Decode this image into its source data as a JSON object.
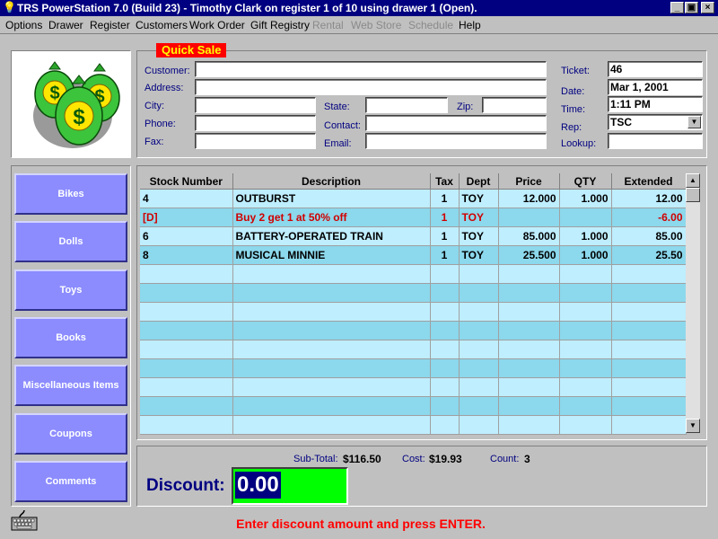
{
  "window": {
    "title": "TRS PowerStation 7.0 (Build 23) - Timothy Clark on register 1 of 10 using drawer 1 (Open).",
    "controls": {
      "minimize": "_",
      "maximize": "▣",
      "close": "×"
    }
  },
  "menu": [
    {
      "label": "Options",
      "enabled": true
    },
    {
      "label": "Drawer",
      "enabled": true
    },
    {
      "label": "Register",
      "enabled": true
    },
    {
      "label": "Customers",
      "enabled": true
    },
    {
      "label": "Work Order",
      "enabled": true
    },
    {
      "label": "Gift Registry",
      "enabled": true
    },
    {
      "label": "Rental",
      "enabled": false
    },
    {
      "label": "Web Store",
      "enabled": false
    },
    {
      "label": "Schedule",
      "enabled": false
    },
    {
      "label": "Help",
      "enabled": true
    }
  ],
  "header": {
    "mode_label": "Quick Sale",
    "customer": {
      "customer_label": "Customer:",
      "customer_value": "",
      "address_label": "Address:",
      "address_value": "",
      "city_label": "City:",
      "city_value": "",
      "state_label": "State:",
      "state_value": "",
      "zip_label": "Zip:",
      "zip_value": "",
      "phone_label": "Phone:",
      "phone_value": "",
      "contact_label": "Contact:",
      "contact_value": "",
      "fax_label": "Fax:",
      "fax_value": "",
      "email_label": "Email:",
      "email_value": ""
    },
    "ticket": {
      "ticket_label": "Ticket:",
      "ticket_value": "46",
      "date_label": "Date:",
      "date_value": "Mar 1, 2001",
      "time_label": "Time:",
      "time_value": "1:11 PM",
      "rep_label": "Rep:",
      "rep_value": "TSC",
      "lookup_label": "Lookup:",
      "lookup_value": ""
    }
  },
  "categories": [
    "Bikes",
    "Dolls",
    "Toys",
    "Books",
    "Miscellaneous Items",
    "Coupons",
    "Comments"
  ],
  "grid": {
    "columns": [
      "Stock Number",
      "Description",
      "Tax",
      "Dept",
      "Price",
      "QTY",
      "Extended"
    ],
    "rows": [
      {
        "stock": "4",
        "description": "OUTBURST",
        "tax": "1",
        "dept": "TOY",
        "price": "12.000",
        "qty": "1.000",
        "extended": "12.00",
        "discount": false
      },
      {
        "stock": "[D]",
        "description": "Buy 2 get 1 at 50% off",
        "tax": "1",
        "dept": "TOY",
        "price": "",
        "qty": "",
        "extended": "-6.00",
        "discount": true
      },
      {
        "stock": "6",
        "description": "BATTERY-OPERATED TRAIN",
        "tax": "1",
        "dept": "TOY",
        "price": "85.000",
        "qty": "1.000",
        "extended": "85.00",
        "discount": false
      },
      {
        "stock": "8",
        "description": "MUSICAL MINNIE",
        "tax": "1",
        "dept": "TOY",
        "price": "25.500",
        "qty": "1.000",
        "extended": "25.50",
        "discount": false
      }
    ],
    "empty_rows": 9
  },
  "totals": {
    "subtotal_label": "Sub-Total:",
    "subtotal_value": "$116.50",
    "cost_label": "Cost:",
    "cost_value": "$19.93",
    "count_label": "Count:",
    "count_value": "3"
  },
  "discount": {
    "label": "Discount:",
    "value": "0.00"
  },
  "status_message": "Enter discount amount and press ENTER.",
  "colors": {
    "title_bar": "#000080",
    "category_button": "#8c8cff",
    "grid_row_light": "#bfeeff",
    "grid_row_dark": "#8cd8ec",
    "discount_text": "#d00000",
    "quick_sale_bg": "#ff0000",
    "discount_field_bg": "#00ff00",
    "status_text": "#ff0000"
  },
  "icons": {
    "app": "lightbulb-icon",
    "logo": "money-bags-logo",
    "keyboard": "keyboard-icon",
    "rep_dropdown": "chevron-down-icon"
  }
}
